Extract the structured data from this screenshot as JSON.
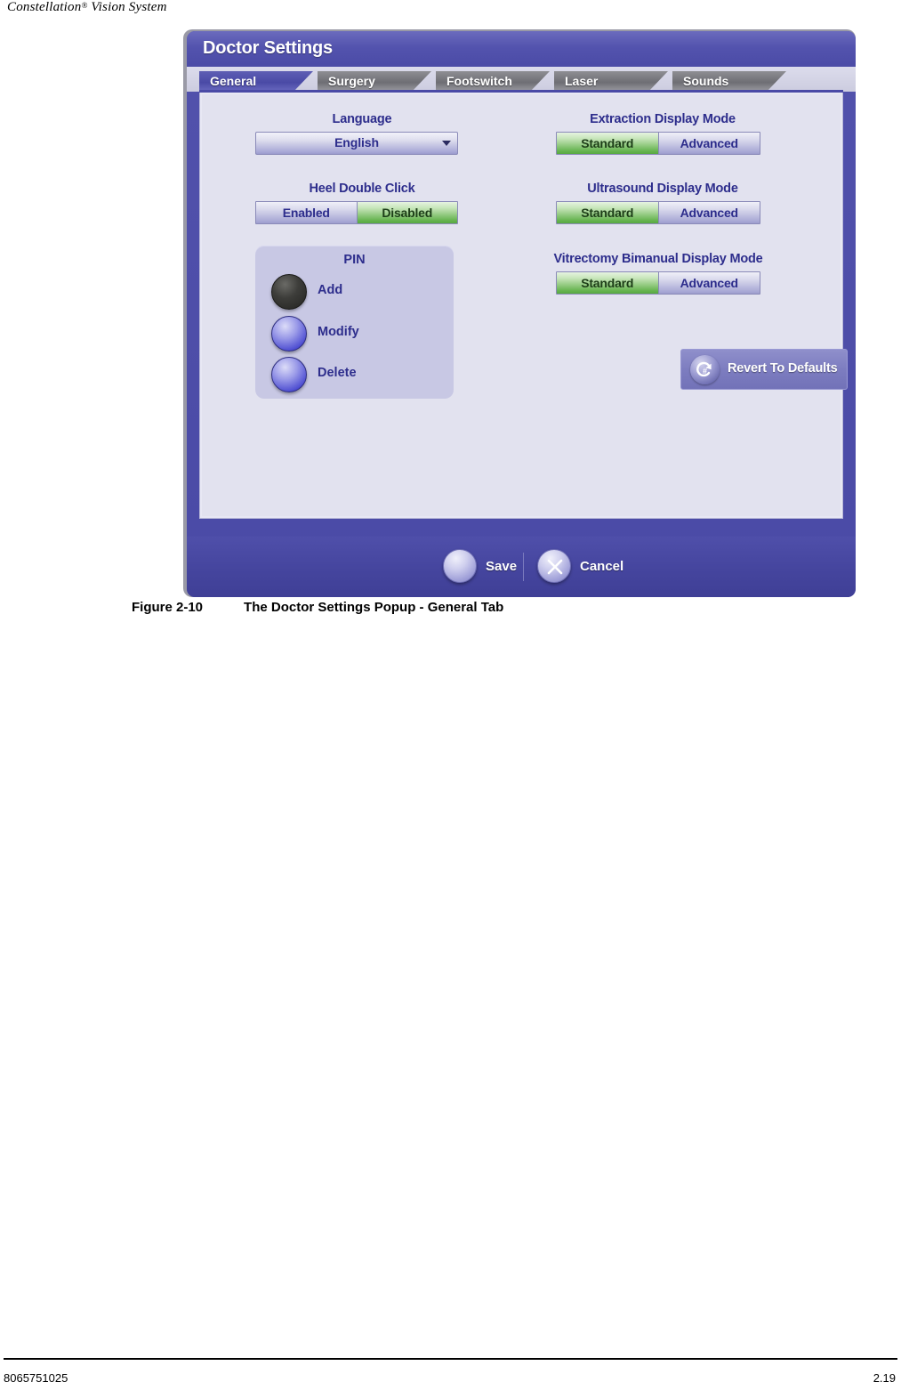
{
  "page": {
    "header_title": "Constellation",
    "header_mark": "®",
    "header_rest": " Vision System",
    "footer_doc_number": "8065751025",
    "footer_page_number": "2.19"
  },
  "figure": {
    "number": "Figure 2-10",
    "caption": "The Doctor Settings Popup - General Tab"
  },
  "dialog": {
    "title": "Doctor Settings",
    "tabs": [
      {
        "label": "General",
        "active": true
      },
      {
        "label": "Surgery",
        "active": false
      },
      {
        "label": "Footswitch",
        "active": false
      },
      {
        "label": "Laser",
        "active": false
      },
      {
        "label": "Sounds",
        "active": false
      }
    ],
    "left_column": {
      "language": {
        "label": "Language",
        "selected": "English",
        "arrow_icon": "chevron-down-icon"
      },
      "heel_double_click": {
        "label": "Heel Double Click",
        "option_left": "Enabled",
        "option_right": "Disabled",
        "selected": "Disabled"
      },
      "pin": {
        "label": "PIN",
        "buttons": [
          {
            "label": "Add",
            "state": "disabled"
          },
          {
            "label": "Modify",
            "state": "enabled"
          },
          {
            "label": "Delete",
            "state": "enabled"
          }
        ]
      }
    },
    "right_column": {
      "extraction_display_mode": {
        "label": "Extraction Display Mode",
        "option_left": "Standard",
        "option_right": "Advanced",
        "selected": "Standard"
      },
      "ultrasound_display_mode": {
        "label": "Ultrasound Display Mode",
        "option_left": "Standard",
        "option_right": "Advanced",
        "selected": "Standard"
      },
      "vitrectomy_bimanual_display_mode": {
        "label": "Vitrectomy Bimanual Display Mode",
        "option_left": "Standard",
        "option_right": "Advanced",
        "selected": "Standard"
      }
    },
    "revert": {
      "label": "Revert To Defaults",
      "icon": "revert-arrow-icon"
    },
    "footer": {
      "save_label": "Save",
      "cancel_label": "Cancel",
      "cancel_icon": "close-x-icon"
    }
  },
  "colors": {
    "dialog_purple": "#4a4aa6",
    "title_purple": "#5353ae",
    "panel_bg": "#e2e2ef",
    "label_blue": "#2d2d8c",
    "toggle_on_green": "#63b24c",
    "toggle_off_purple": "#a6a6d4",
    "pin_panel": "#c8c8e4",
    "tab_inactive_gray": "#6e6e74"
  }
}
